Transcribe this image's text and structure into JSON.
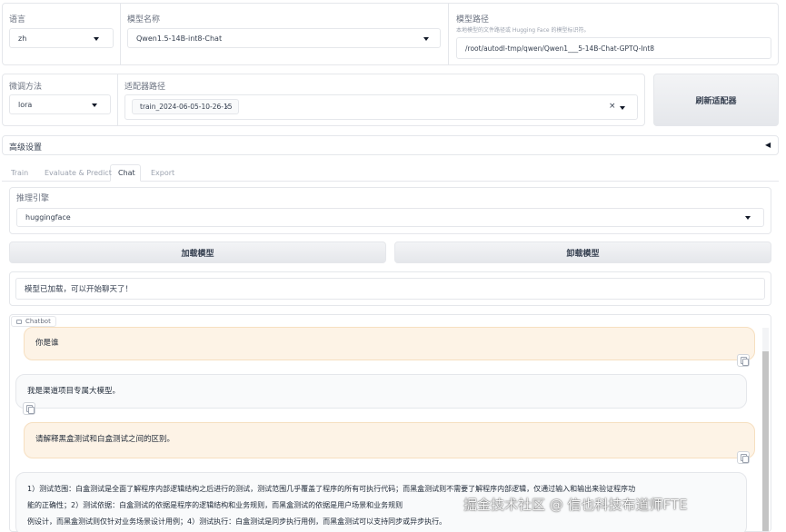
{
  "language": {
    "label": "语言",
    "value": "zh"
  },
  "model_name": {
    "label": "模型名称",
    "value": "Qwen1.5-14B-int8-Chat"
  },
  "model_path": {
    "label": "模型路径",
    "hint": "本地模型的文件路径或 Hugging Face 的模型标识符。",
    "value": "/root/autodl-tmp/qwen/Qwen1___5-14B-Chat-GPTQ-Int8"
  },
  "finetune": {
    "label": "微调方法",
    "value": "lora"
  },
  "adapter": {
    "label": "适配器路径",
    "chip": "train_2024-06-05-10-26-15",
    "chip_remove": "×",
    "clear": "×"
  },
  "refresh_button": "刷新适配器",
  "advanced": {
    "label": "高级设置",
    "toggle": "◀"
  },
  "tabs": [
    "Train",
    "Evaluate & Predict",
    "Chat",
    "Export"
  ],
  "active_tab": "Chat",
  "infer": {
    "label": "推理引擎",
    "value": "huggingface"
  },
  "load_button": "加载模型",
  "unload_button": "卸载模型",
  "status": "模型已加载，可以开始聊天了！",
  "chatbot": {
    "label": "Chatbot",
    "messages": [
      {
        "role": "user",
        "text": "你是谁"
      },
      {
        "role": "bot",
        "text": "我是渠道项目专属大模型。"
      },
      {
        "role": "user",
        "text": "请解释黑盒测试和白盒测试之间的区别。"
      },
      {
        "role": "bot",
        "lines": [
          "1）测试范围：白盒测试是全面了解程序内部逻辑结构之后进行的测试，测试范围几乎覆盖了程序的所有可执行代码；而黑盒测试则不需要了解程序内部逻辑，仅通过输入和输出来验证程序功",
          "能的正确性；2）测试依据：白盒测试的依据是程序的逻辑结构和业务规则，而黑盒测试的依据是用户场景和业务规则",
          "例设计，而黑盒测试则仅针对业务场景设计用例；4）测试执行：白盒测试是同步执行用例，而黑盒测试可以支持同步或异步执行。"
        ]
      }
    ]
  },
  "watermark": "掘金技术社区 @ 信也科技布道师FTE",
  "colors": {
    "user_bubble": "#fdf3e6",
    "bot_bubble": "#f9fafb",
    "border": "#e5e7eb"
  }
}
